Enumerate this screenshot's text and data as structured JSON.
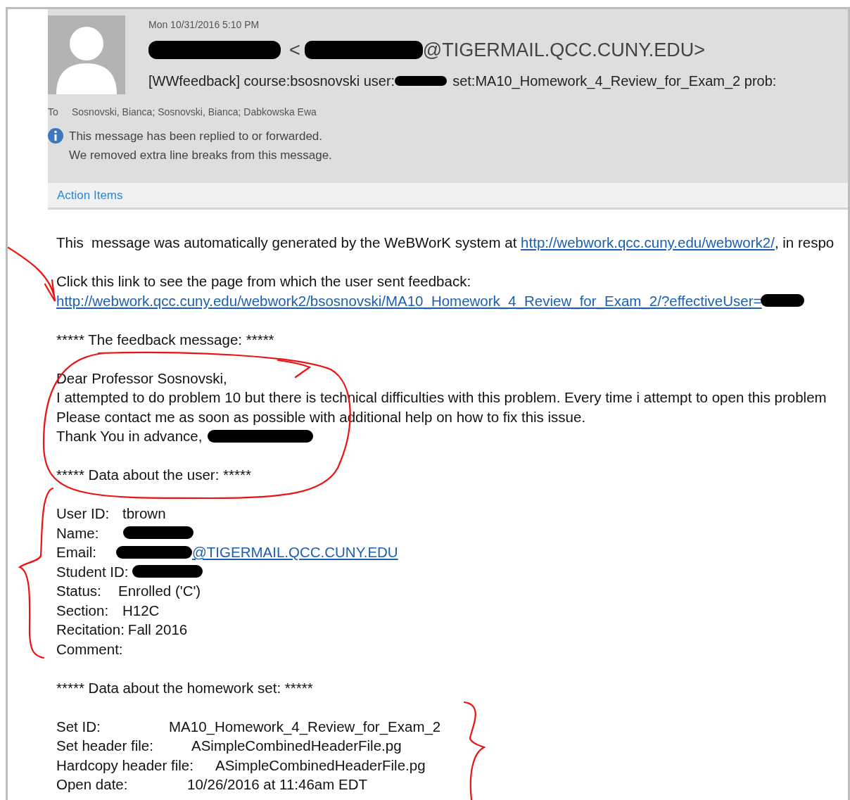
{
  "message_header": {
    "date": "Mon 10/31/2016 5:10 PM",
    "sender_open": "<",
    "sender_domain": "@TIGERMAIL.QCC.CUNY.EDU>",
    "subject_start": "[WWfeedback] course:bsosnovski user:",
    "subject_end": "set:MA10_Homework_4_Review_for_Exam_2 prob:",
    "to_label": "To",
    "recipients": "Sosnovski, Bianca; Sosnovski, Bianca; Dabkowska Ewa",
    "notices": [
      "This message has been replied to or forwarded.",
      "We removed extra line breaks from this message."
    ]
  },
  "action_items": "Action Items",
  "body": [
    {
      "kind": "mixed",
      "text": "This  message was automatically generated by the WeBWorK system at ",
      "link": "http://webwork.qcc.cuny.edu/webwork2/",
      "after": ", in respo"
    },
    {
      "kind": "blank"
    },
    {
      "kind": "text",
      "text": "Click this link to see the page from which the user sent feedback:"
    },
    {
      "kind": "link",
      "text": "http://webwork.qcc.cuny.edu/webwork2/bsosnovski/MA10_Homework_4_Review_for_Exam_2/?effectiveUser=",
      "redacted": true
    },
    {
      "kind": "blank"
    },
    {
      "kind": "text",
      "text": "***** The feedback message: *****"
    },
    {
      "kind": "blank"
    },
    {
      "kind": "text",
      "text": "Dear Professor Sosnovski,"
    },
    {
      "kind": "text",
      "text": "I attempted to do problem 10 but there is technical difficulties with this problem. Every time i attempt to open this problem"
    },
    {
      "kind": "text",
      "text": "Please contact me as soon as possible with additional help on how to fix this issue."
    },
    {
      "kind": "text",
      "text": "Thank You in advance,",
      "redacted": true
    },
    {
      "kind": "blank"
    },
    {
      "kind": "text",
      "text": "***** Data about the user: *****"
    },
    {
      "kind": "blank"
    },
    {
      "kind": "user_field",
      "label": "User ID:",
      "value": "tbrown"
    },
    {
      "kind": "user_field",
      "label": "Name:",
      "redacted": true
    },
    {
      "kind": "user_field",
      "label": "Email:",
      "link": "@TIGERMAIL.QCC.CUNY.EDU",
      "redacted": true
    },
    {
      "kind": "user_field",
      "label": "Student ID:",
      "redacted": true
    },
    {
      "kind": "user_field",
      "label": "Status:",
      "value": "Enrolled ('C')"
    },
    {
      "kind": "user_field",
      "label": "Section:",
      "value": "H12C"
    },
    {
      "kind": "user_field",
      "label": "Recitation:",
      "value": "Fall 2016"
    },
    {
      "kind": "user_field",
      "label": "Comment:"
    },
    {
      "kind": "blank"
    },
    {
      "kind": "text",
      "text": "***** Data about the homework set: *****"
    },
    {
      "kind": "blank"
    },
    {
      "kind": "set_field",
      "label": "Set ID:",
      "value": "MA10_Homework_4_Review_for_Exam_2"
    },
    {
      "kind": "set_field",
      "label": "Set header file:",
      "value": "ASimpleCombinedHeaderFile.pg"
    },
    {
      "kind": "set_field",
      "label": "Hardcopy header file:",
      "value": "ASimpleCombinedHeaderFile.pg"
    },
    {
      "kind": "set_field",
      "label": "Open date:",
      "value": "10/26/2016 at 11:46am EDT"
    }
  ]
}
